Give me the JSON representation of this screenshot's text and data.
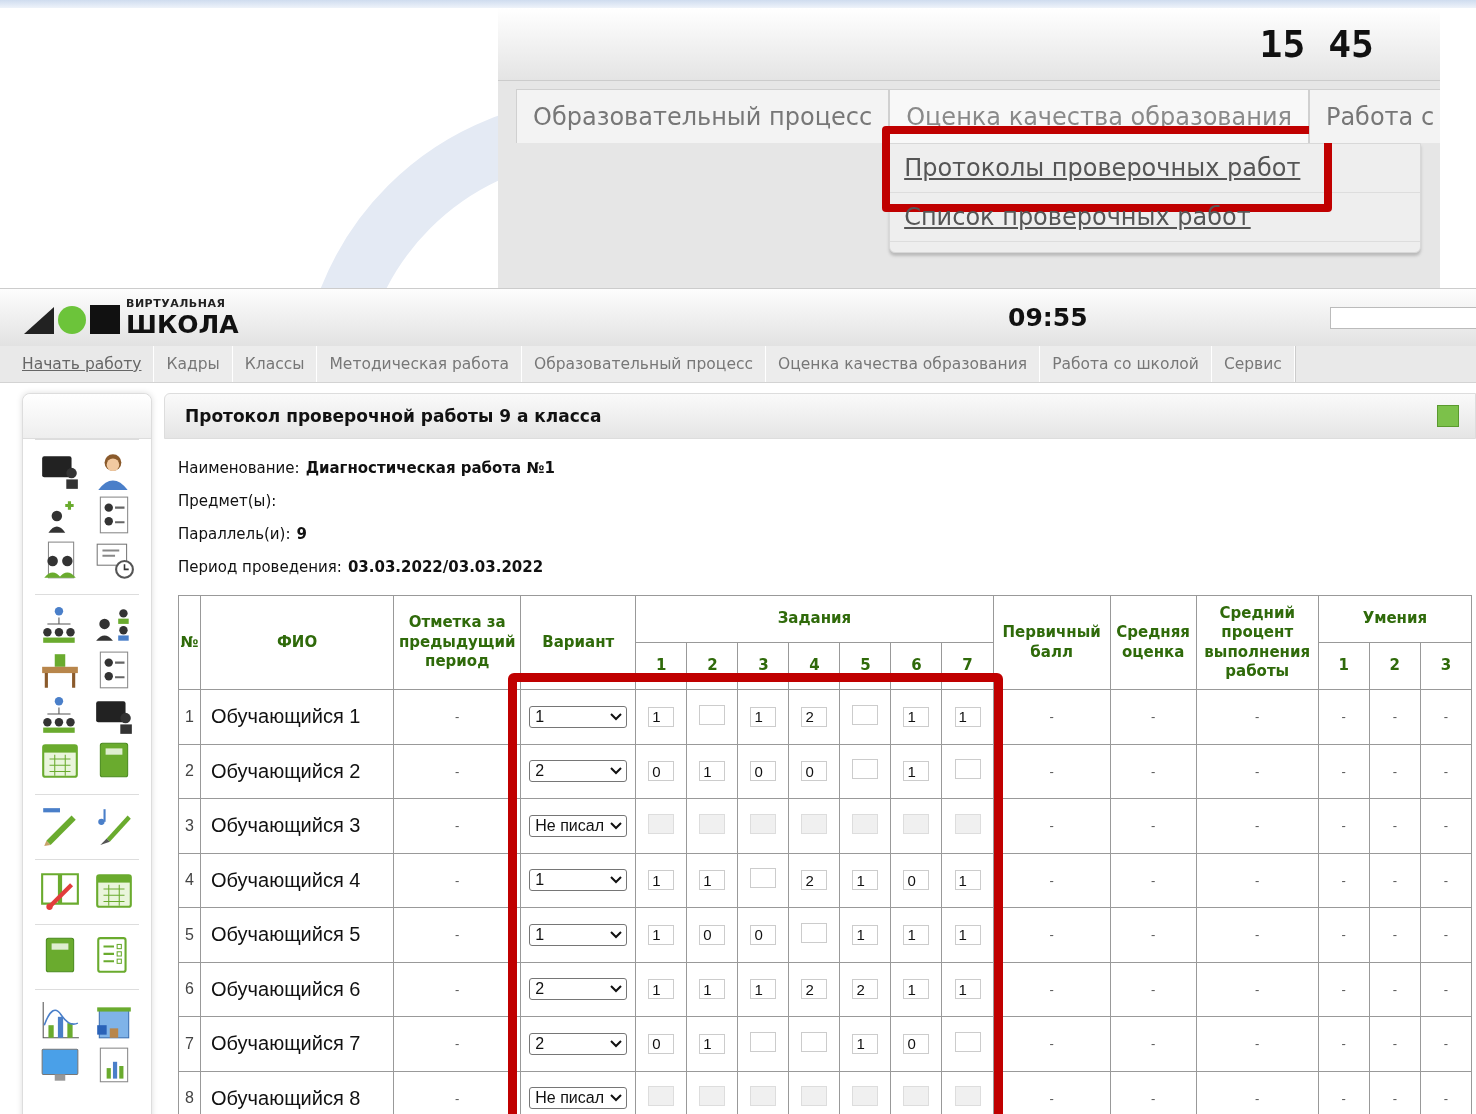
{
  "top_screen": {
    "clock": "15 45",
    "tabs": [
      {
        "label": "Образовательный процесс",
        "selected": false
      },
      {
        "label": "Оценка качества образования",
        "selected": true
      },
      {
        "label": "Работа с",
        "selected": false
      }
    ],
    "menu_items": [
      {
        "label": "Протоколы проверочных работ",
        "highlighted": true
      },
      {
        "label": "Список проверочных работ",
        "highlighted": false
      }
    ]
  },
  "header": {
    "logo_small": "ВИРТУАЛЬНАЯ",
    "logo_big": "ШКОЛА",
    "clock": "09:55"
  },
  "nav_tabs": [
    {
      "label": "Начать работу",
      "kind": "link"
    },
    {
      "label": "Кадры",
      "kind": "tab"
    },
    {
      "label": "Классы",
      "kind": "tab"
    },
    {
      "label": "Методическая работа",
      "kind": "tab"
    },
    {
      "label": "Образовательный процесс",
      "kind": "tab"
    },
    {
      "label": "Оценка качества образования",
      "kind": "tab"
    },
    {
      "label": "Работа со школой",
      "kind": "tab"
    },
    {
      "label": "Сервис",
      "kind": "tab"
    }
  ],
  "panel": {
    "title": "Протокол проверочной работы 9 а класса",
    "fields": [
      {
        "label": "Наименование:",
        "value": "Диагностическая работа №1"
      },
      {
        "label": "Предмет(ы):"
      },
      {
        "label": "Параллель(и):",
        "value": "9"
      },
      {
        "label": "Период проведения:",
        "value": "03.03.2022/03.03.2022"
      }
    ]
  },
  "table": {
    "highlighted": true,
    "columns": {
      "num": "№",
      "name": "ФИО",
      "prev_mark": "Отметка за предыдущий период",
      "variant": "Вариант",
      "tasks": "Задания",
      "task_numbers": [
        "1",
        "2",
        "3",
        "4",
        "5",
        "6",
        "7"
      ],
      "primary_score": "Первичный балл",
      "avg_mark": "Средняя оценка",
      "avg_percent": "Средний процент выполнения работы",
      "skills": "Умения",
      "skill_numbers": [
        "1",
        "2",
        "3"
      ]
    },
    "rows": [
      {
        "num": "1",
        "name": "Обучающийся 1",
        "prev_mark": "-",
        "variant": "1",
        "tasks_disabled": false,
        "scores": {
          "1": "1",
          "3": "1",
          "4": "2",
          "6": "1",
          "7": "1"
        },
        "primary_score": "-",
        "avg_mark": "-",
        "avg_percent": "-",
        "skills": [
          "-",
          "-",
          "-"
        ]
      },
      {
        "num": "2",
        "name": "Обучающийся 2",
        "prev_mark": "-",
        "variant": "2",
        "tasks_disabled": false,
        "scores": {
          "1": "0",
          "2": "1",
          "3": "0",
          "4": "0",
          "6": "1"
        },
        "primary_score": "-",
        "avg_mark": "-",
        "avg_percent": "-",
        "skills": [
          "-",
          "-",
          "-"
        ]
      },
      {
        "num": "3",
        "name": "Обучающийся 3",
        "prev_mark": "-",
        "variant": "Не писал",
        "tasks_disabled": true,
        "primary_score": "-",
        "avg_mark": "-",
        "avg_percent": "-",
        "skills": [
          "-",
          "-",
          "-"
        ]
      },
      {
        "num": "4",
        "name": "Обучающийся 4",
        "prev_mark": "-",
        "variant": "1",
        "tasks_disabled": false,
        "scores": {
          "1": "1",
          "2": "1",
          "4": "2",
          "5": "1",
          "6": "0",
          "7": "1"
        },
        "primary_score": "-",
        "avg_mark": "-",
        "avg_percent": "-",
        "skills": [
          "-",
          "-",
          "-"
        ]
      },
      {
        "num": "5",
        "name": "Обучающийся 5",
        "prev_mark": "-",
        "variant": "1",
        "tasks_disabled": false,
        "scores": {
          "1": "1",
          "2": "0",
          "3": "0",
          "5": "1",
          "6": "1",
          "7": "1"
        },
        "primary_score": "-",
        "avg_mark": "-",
        "avg_percent": "-",
        "skills": [
          "-",
          "-",
          "-"
        ]
      },
      {
        "num": "6",
        "name": "Обучающийся 6",
        "prev_mark": "-",
        "variant": "2",
        "tasks_disabled": false,
        "scores": {
          "1": "1",
          "2": "1",
          "3": "1",
          "4": "2",
          "5": "2",
          "6": "1",
          "7": "1"
        },
        "primary_score": "-",
        "avg_mark": "-",
        "avg_percent": "-",
        "skills": [
          "-",
          "-",
          "-"
        ]
      },
      {
        "num": "7",
        "name": "Обучающийся 7",
        "prev_mark": "-",
        "variant": "2",
        "tasks_disabled": false,
        "scores": {
          "1": "0",
          "2": "1",
          "5": "1",
          "6": "0"
        },
        "primary_score": "-",
        "avg_mark": "-",
        "avg_percent": "-",
        "skills": [
          "-",
          "-",
          "-"
        ]
      },
      {
        "num": "8",
        "name": "Обучающийся 8",
        "prev_mark": "-",
        "variant": "Не писал",
        "tasks_disabled": true,
        "primary_score": "-",
        "avg_mark": "-",
        "avg_percent": "-",
        "skills": [
          "-",
          "-",
          "-"
        ]
      }
    ]
  }
}
